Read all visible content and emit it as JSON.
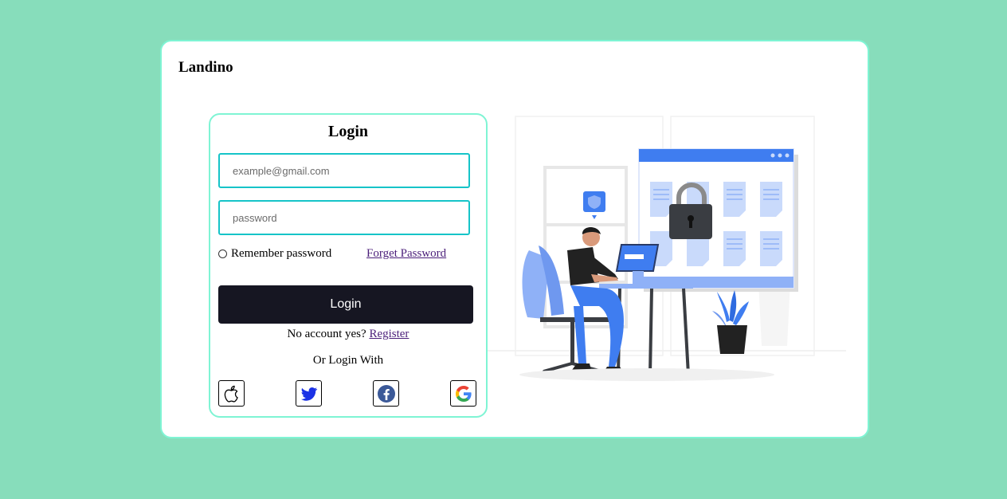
{
  "brand": "Landino",
  "login": {
    "title": "Login",
    "email_placeholder": "example@gmail.com",
    "password_placeholder": "password",
    "remember_label": "Remember password",
    "forget_label": "Forget Password",
    "submit_label": "Login",
    "no_account_text": "No account yes?",
    "register_label": "Register",
    "or_login_with": "Or Login With"
  },
  "social_icons": [
    "apple-icon",
    "twitter-icon",
    "facebook-icon",
    "google-icon"
  ],
  "colors": {
    "background": "#87ddbb",
    "border_accent": "#7ff4d4",
    "input_border": "#16c4c8",
    "button": "#161622",
    "illustration_blue": "#3f7df0"
  }
}
